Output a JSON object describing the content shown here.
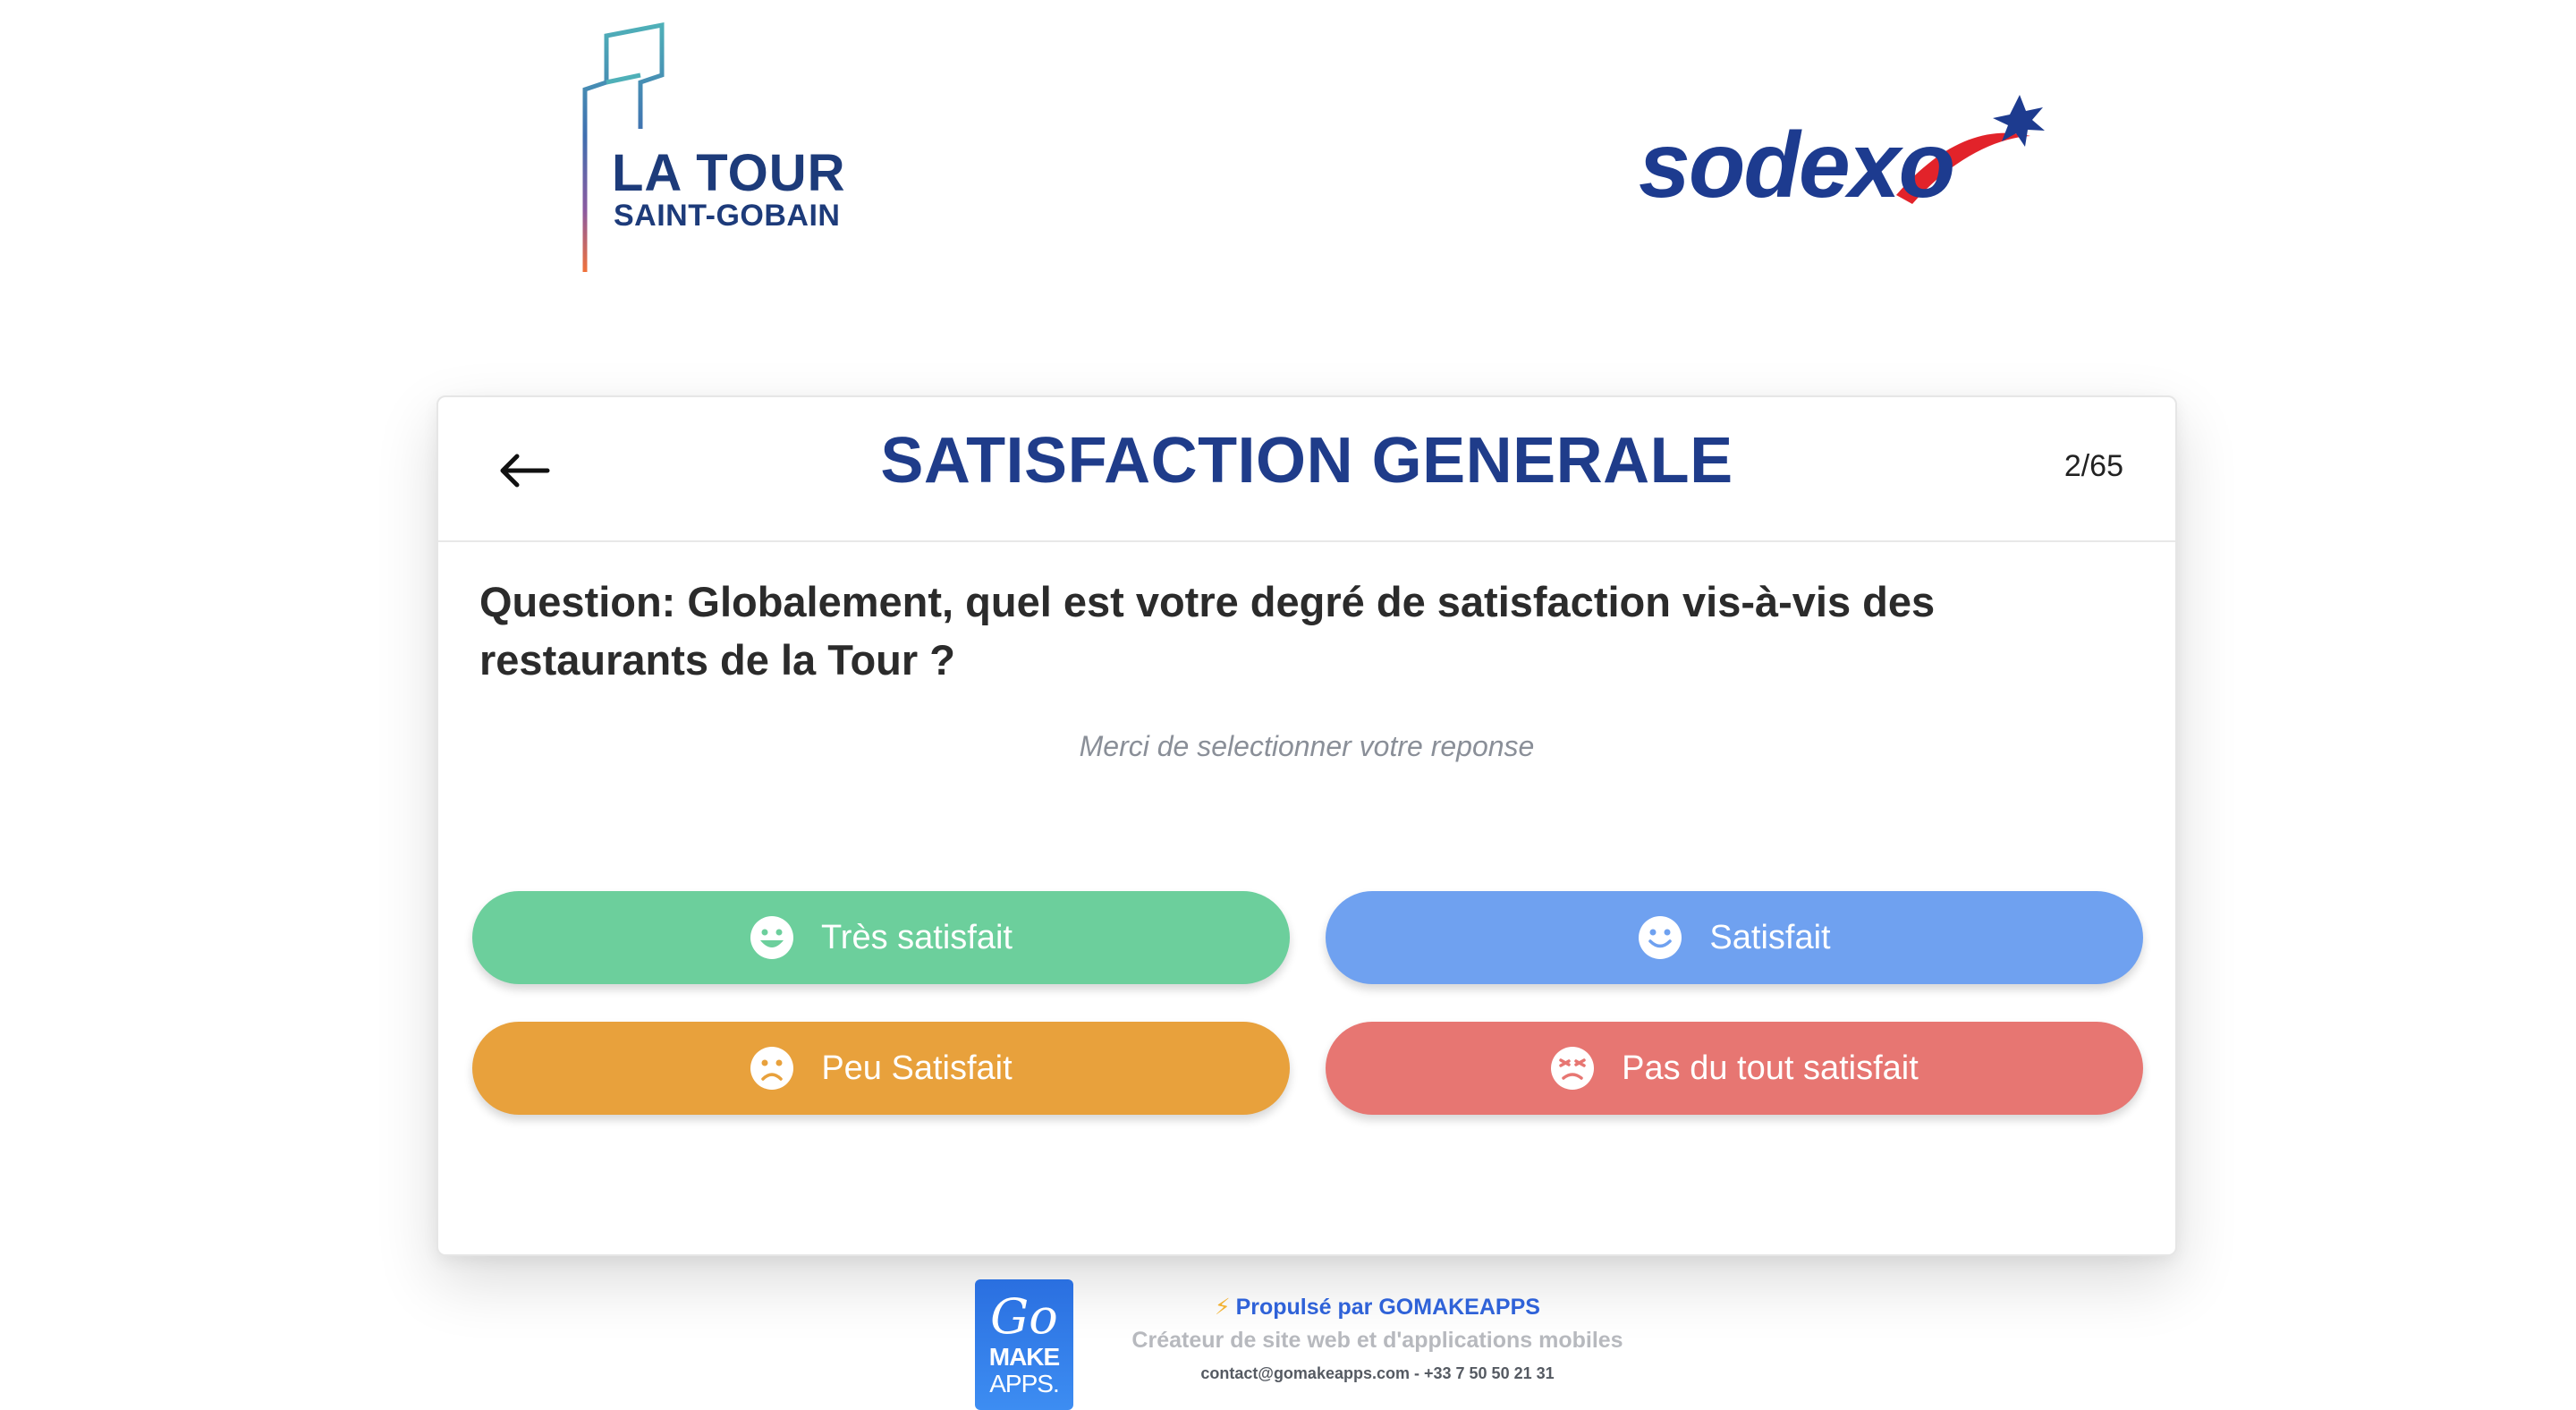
{
  "logos": {
    "left": {
      "line1": "LA TOUR",
      "line2": "SAINT-GOBAIN",
      "icon": "tower-icon"
    },
    "right": {
      "text": "sodexo",
      "icon": "star-icon"
    }
  },
  "card": {
    "title": "SATISFACTION GENERALE",
    "progress": "2/65",
    "back_icon": "arrow-left-icon",
    "question": "Question: Globalement, quel est votre degré de satisfaction vis-à-vis des restaurants de la Tour ?",
    "hint": "Merci de selectionner votre reponse",
    "answers": [
      {
        "label": "Très satisfait",
        "color": "#6ccf9c",
        "icon": "very-happy-face-icon"
      },
      {
        "label": "Satisfait",
        "color": "#6fa1f0",
        "icon": "happy-face-icon"
      },
      {
        "label": "Peu Satisfait",
        "color": "#e8a13c",
        "icon": "sad-face-icon"
      },
      {
        "label": "Pas du tout satisfait",
        "color": "#e77672",
        "icon": "angry-face-icon"
      }
    ]
  },
  "footer": {
    "logo_go": "Go",
    "logo_make": "MAKE",
    "logo_apps": "APPS.",
    "powered": "Propulsé par GOMAKEAPPS",
    "tagline": "Créateur de site web et d'applications mobiles",
    "contact": "contact@gomakeapps.com - +33 7 50 50 21 31"
  },
  "colors": {
    "title": "#1f3c8a",
    "brand_blue": "#1d3b8f",
    "sodexo_red": "#e2232a"
  }
}
